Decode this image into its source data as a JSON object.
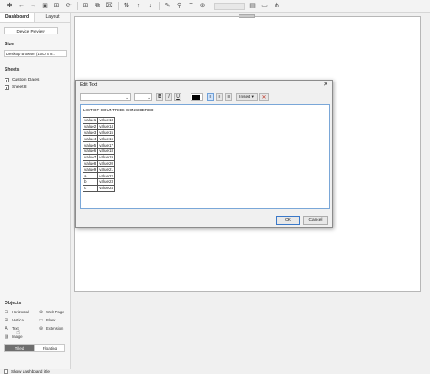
{
  "left_pane": {
    "tabs": [
      {
        "label": "Dashboard"
      },
      {
        "label": "Layout"
      }
    ],
    "device_preview_label": "Device Preview",
    "size_title": "Size",
    "size_value": "Desktop Browser (1000 x 8...",
    "sheets_title": "Sheets",
    "sheets": [
      {
        "label": "Custom Dates"
      },
      {
        "label": "Sheet 8"
      }
    ],
    "objects_title": "Objects",
    "objects": [
      {
        "label": "Horizontal",
        "icon": "horizontal-container-icon"
      },
      {
        "label": "Web Page",
        "icon": "globe-icon"
      },
      {
        "label": "Vertical",
        "icon": "vertical-container-icon"
      },
      {
        "label": "Blank",
        "icon": "blank-icon"
      },
      {
        "label": "Text",
        "icon": "text-icon"
      },
      {
        "label": "Extension",
        "icon": "extension-icon"
      },
      {
        "label": "Image",
        "icon": "image-icon"
      }
    ],
    "tiled_label": "Tiled",
    "floating_label": "Floating",
    "show_title_label": "Show dashboard title"
  },
  "dialog": {
    "title": "Edit Text",
    "close_glyph": "✕",
    "toolbar": {
      "bold": "B",
      "italic": "I",
      "underline": "U",
      "insert_label": "Insert ▾",
      "clear_glyph": "✕",
      "text_color": "#000000"
    },
    "heading": "LIST OF COUNTRIES CONSIDERED",
    "rows": [
      [
        "value1",
        "value13"
      ],
      [
        "value2",
        "value14"
      ],
      [
        "value3",
        "value15"
      ],
      [
        "value4",
        "value16"
      ],
      [
        "value5",
        "value17"
      ],
      [
        "value6",
        "value18"
      ],
      [
        "value7",
        "value19"
      ],
      [
        "value8",
        "value20"
      ],
      [
        "value9",
        "value21"
      ],
      [
        "a",
        "value22"
      ],
      [
        "b",
        "value23"
      ],
      [
        "c",
        "value24"
      ]
    ],
    "ok_label": "OK",
    "cancel_label": "Cancel"
  },
  "colors": {
    "accent": "#3a78c8",
    "tiled_bg": "#6e6e6e"
  }
}
